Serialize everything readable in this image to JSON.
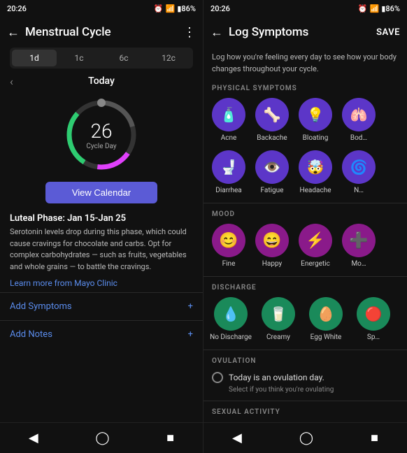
{
  "left": {
    "status_time": "20:26",
    "status_icons": "⏰ 📶 86%",
    "header_title": "Menstrual Cycle",
    "tabs": [
      "1d",
      "1c",
      "6c",
      "12c"
    ],
    "active_tab": 0,
    "nav_label": "Today",
    "cycle_day_num": "26",
    "cycle_day_label": "Cycle Day",
    "view_calendar_btn": "View Calendar",
    "phase_title": "Luteal Phase: Jan 15-Jan 25",
    "phase_desc": "Serotonin levels drop during this phase, which could cause cravings for chocolate and carbs. Opt for complex carbohydrates — such as fruits, vegetables and whole grains — to battle the cravings.",
    "mayo_link": "Learn more from Mayo Clinic",
    "add_symptoms_label": "Add Symptoms",
    "add_notes_label": "Add Notes"
  },
  "right": {
    "status_time": "20:26",
    "header_title": "Log Symptoms",
    "save_label": "SAVE",
    "subtitle": "Log how you're feeling every day to see how your body changes throughout your cycle.",
    "sections": {
      "physical": {
        "label": "PHYSICAL SYMPTOMS",
        "items": [
          {
            "icon": "💊",
            "label": "Acne"
          },
          {
            "icon": "🦴",
            "label": "Backache"
          },
          {
            "icon": "💨",
            "label": "Bloating"
          },
          {
            "icon": "➕",
            "label": "Bod..."
          },
          {
            "icon": "🚽",
            "label": "Diarrhea"
          },
          {
            "icon": "😴",
            "label": "Fatigue"
          },
          {
            "icon": "🤕",
            "label": "Headache"
          },
          {
            "icon": "➡️",
            "label": "N..."
          }
        ]
      },
      "mood": {
        "label": "MOOD",
        "items": [
          {
            "icon": "😊",
            "label": "Fine"
          },
          {
            "icon": "😄",
            "label": "Happy"
          },
          {
            "icon": "⚡",
            "label": "Energetic"
          },
          {
            "icon": "➕",
            "label": "Mo..."
          }
        ]
      },
      "discharge": {
        "label": "DISCHARGE",
        "items": [
          {
            "icon": "💧",
            "label": "No Discharge"
          },
          {
            "icon": "🥛",
            "label": "Creamy"
          },
          {
            "icon": "🥚",
            "label": "Egg White"
          },
          {
            "icon": "➕",
            "label": "Sp..."
          }
        ]
      },
      "ovulation": {
        "label": "OVULATION",
        "ovulation_text": "Today is an ovulation day.",
        "ovulation_sub": "Select if you think you're ovulating"
      },
      "sexual_activity": {
        "label": "SEXUAL ACTIVITY"
      }
    }
  }
}
